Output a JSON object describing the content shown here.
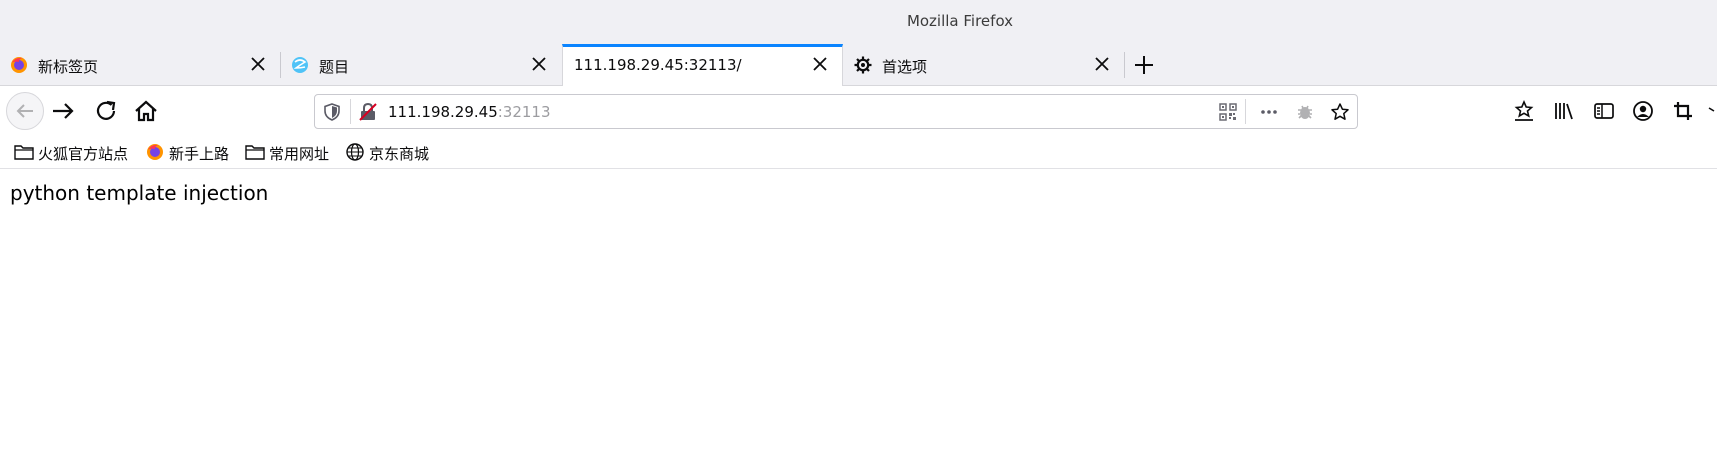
{
  "window": {
    "title": "Mozilla Firefox"
  },
  "tabs": [
    {
      "title": "新标签页",
      "icon": "firefox-icon",
      "active": false
    },
    {
      "title": "题目",
      "icon": "site-globe-icon",
      "active": false
    },
    {
      "title": "111.198.29.45:32113/",
      "icon": "none",
      "active": true
    },
    {
      "title": "首选项",
      "icon": "gear-icon",
      "active": false
    }
  ],
  "urlbar": {
    "host": "111.198.29.45",
    "port": ":32113"
  },
  "bookmarks": [
    {
      "label": "火狐官方站点",
      "icon": "folder-icon"
    },
    {
      "label": "新手上路",
      "icon": "firefox-icon"
    },
    {
      "label": "常用网址",
      "icon": "folder-icon"
    },
    {
      "label": "京东商城",
      "icon": "globe-icon"
    }
  ],
  "content": {
    "text": "python template injection"
  },
  "colors": {
    "accent": "#0a84ff",
    "chrome_bg": "#f0f0f4"
  }
}
